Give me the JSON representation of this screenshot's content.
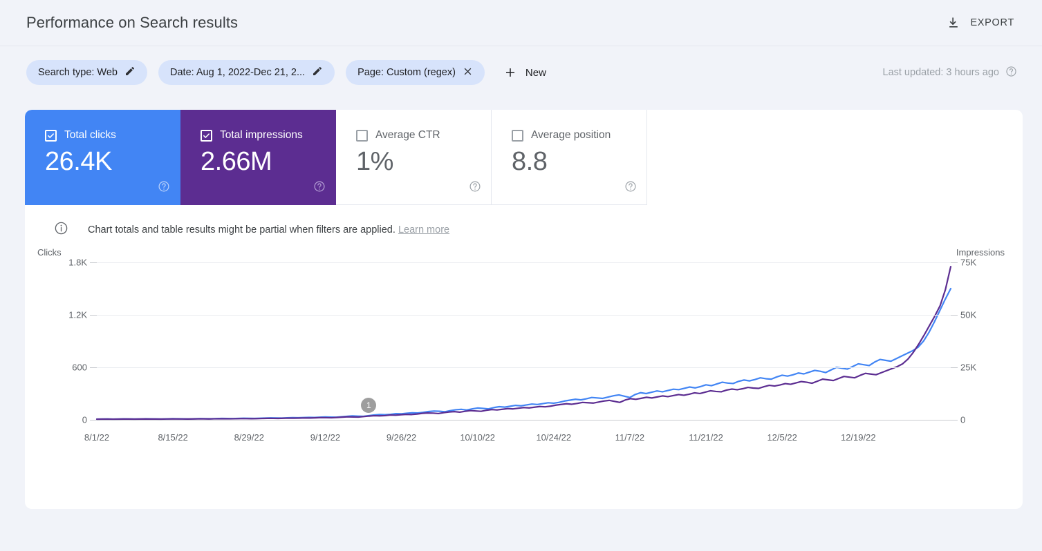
{
  "header": {
    "title": "Performance on Search results",
    "export_label": "EXPORT",
    "export_icon": "download-icon"
  },
  "filters": {
    "chips": [
      {
        "label": "Search type: Web",
        "action_icon": "pencil-icon"
      },
      {
        "label": "Date: Aug 1, 2022-Dec 21, 2...",
        "action_icon": "pencil-icon"
      },
      {
        "label": "Page: Custom (regex)",
        "action_icon": "close-icon"
      }
    ],
    "new_label": "New",
    "new_icon": "plus-icon",
    "last_updated": "Last updated: 3 hours ago",
    "help_icon": "help-circle-icon"
  },
  "metrics": [
    {
      "label": "Total clicks",
      "value": "26.4K",
      "selected": true,
      "color": "#4285F4"
    },
    {
      "label": "Total impressions",
      "value": "2.66M",
      "selected": true,
      "color": "#5C2D91"
    },
    {
      "label": "Average CTR",
      "value": "1%",
      "selected": false,
      "color": "#FFFFFF"
    },
    {
      "label": "Average position",
      "value": "8.8",
      "selected": false,
      "color": "#FFFFFF"
    }
  ],
  "notice": {
    "icon": "info-icon",
    "text": "Chart totals and table results might be partial when filters are applied.",
    "link_label": "Learn more"
  },
  "chart_data": {
    "type": "line",
    "title": "",
    "left_axis_title": "Clicks",
    "right_axis_title": "Impressions",
    "left_ticks": [
      "1.8K",
      "1.2K",
      "600",
      "0"
    ],
    "right_ticks": [
      "75K",
      "50K",
      "25K",
      "0"
    ],
    "ylim_left": [
      0,
      1800
    ],
    "ylim_right": [
      0,
      75000
    ],
    "grid": true,
    "legend": "none",
    "x_tick_labels": [
      "8/1/22",
      "8/15/22",
      "8/29/22",
      "9/12/22",
      "9/26/22",
      "10/10/22",
      "10/24/22",
      "11/7/22",
      "11/21/22",
      "12/5/22",
      "12/19/22"
    ],
    "x_range": [
      "8/1/22",
      "12/21/22"
    ],
    "annotations": [
      {
        "label": "1",
        "x_index": 50
      }
    ],
    "series": [
      {
        "name": "Clicks",
        "color": "#4285F4",
        "axis": "left",
        "values": [
          8,
          9,
          10,
          8,
          9,
          11,
          10,
          9,
          10,
          12,
          11,
          10,
          9,
          11,
          13,
          12,
          11,
          10,
          12,
          14,
          13,
          12,
          14,
          16,
          15,
          14,
          16,
          18,
          17,
          16,
          18,
          20,
          22,
          21,
          20,
          23,
          25,
          24,
          26,
          28,
          27,
          30,
          33,
          31,
          30,
          35,
          40,
          45,
          42,
          40,
          48,
          55,
          60,
          58,
          62,
          70,
          68,
          75,
          80,
          78,
          85,
          95,
          100,
          98,
          92,
          105,
          115,
          120,
          112,
          125,
          135,
          130,
          125,
          140,
          150,
          145,
          155,
          165,
          160,
          170,
          180,
          175,
          185,
          195,
          190,
          200,
          215,
          225,
          235,
          228,
          240,
          255,
          250,
          245,
          260,
          275,
          285,
          270,
          255,
          290,
          310,
          300,
          315,
          330,
          320,
          335,
          350,
          345,
          360,
          375,
          365,
          380,
          400,
          390,
          410,
          430,
          420,
          415,
          440,
          455,
          445,
          460,
          480,
          470,
          465,
          490,
          510,
          500,
          515,
          535,
          525,
          545,
          565,
          555,
          540,
          570,
          600,
          590,
          580,
          610,
          640,
          630,
          620,
          660,
          690,
          680,
          670,
          700,
          730,
          760,
          790,
          830,
          900,
          1000,
          1120,
          1250,
          1380,
          1500
        ]
      },
      {
        "name": "Impressions",
        "color": "#5C2D91",
        "axis": "right",
        "values": [
          300,
          350,
          330,
          310,
          340,
          380,
          360,
          340,
          360,
          400,
          380,
          360,
          340,
          390,
          430,
          410,
          390,
          370,
          410,
          460,
          440,
          420,
          470,
          520,
          500,
          480,
          520,
          570,
          550,
          530,
          580,
          640,
          700,
          680,
          650,
          730,
          800,
          770,
          830,
          890,
          860,
          950,
          1050,
          1000,
          960,
          1120,
          1280,
          1450,
          1350,
          1290,
          1550,
          1780,
          1950,
          1880,
          2000,
          2280,
          2200,
          2420,
          2600,
          2520,
          2750,
          3080,
          3250,
          3180,
          2980,
          3400,
          3720,
          3900,
          3640,
          4050,
          4380,
          4220,
          4050,
          4540,
          4870,
          4700,
          5020,
          5350,
          5190,
          5520,
          5840,
          5680,
          6010,
          6340,
          6180,
          6500,
          6990,
          7320,
          7640,
          7410,
          7800,
          8290,
          8130,
          7970,
          8450,
          8940,
          9260,
          8780,
          8290,
          9420,
          10080,
          9760,
          10240,
          10730,
          10400,
          10890,
          11380,
          11050,
          11540,
          12030,
          11700,
          12190,
          12850,
          12520,
          13170,
          13830,
          13500,
          13340,
          14150,
          14640,
          14320,
          14800,
          15450,
          15130,
          14970,
          15780,
          16430,
          16100,
          16590,
          17240,
          16920,
          17570,
          18220,
          17900,
          17410,
          18380,
          19360,
          19030,
          18710,
          19690,
          20660,
          20340,
          20010,
          21150,
          22130,
          21800,
          21480,
          22450,
          23430,
          24400,
          25380,
          26690,
          28980,
          32180,
          36050,
          40300,
          44850,
          49350,
          54300,
          62000,
          73000
        ]
      }
    ]
  }
}
